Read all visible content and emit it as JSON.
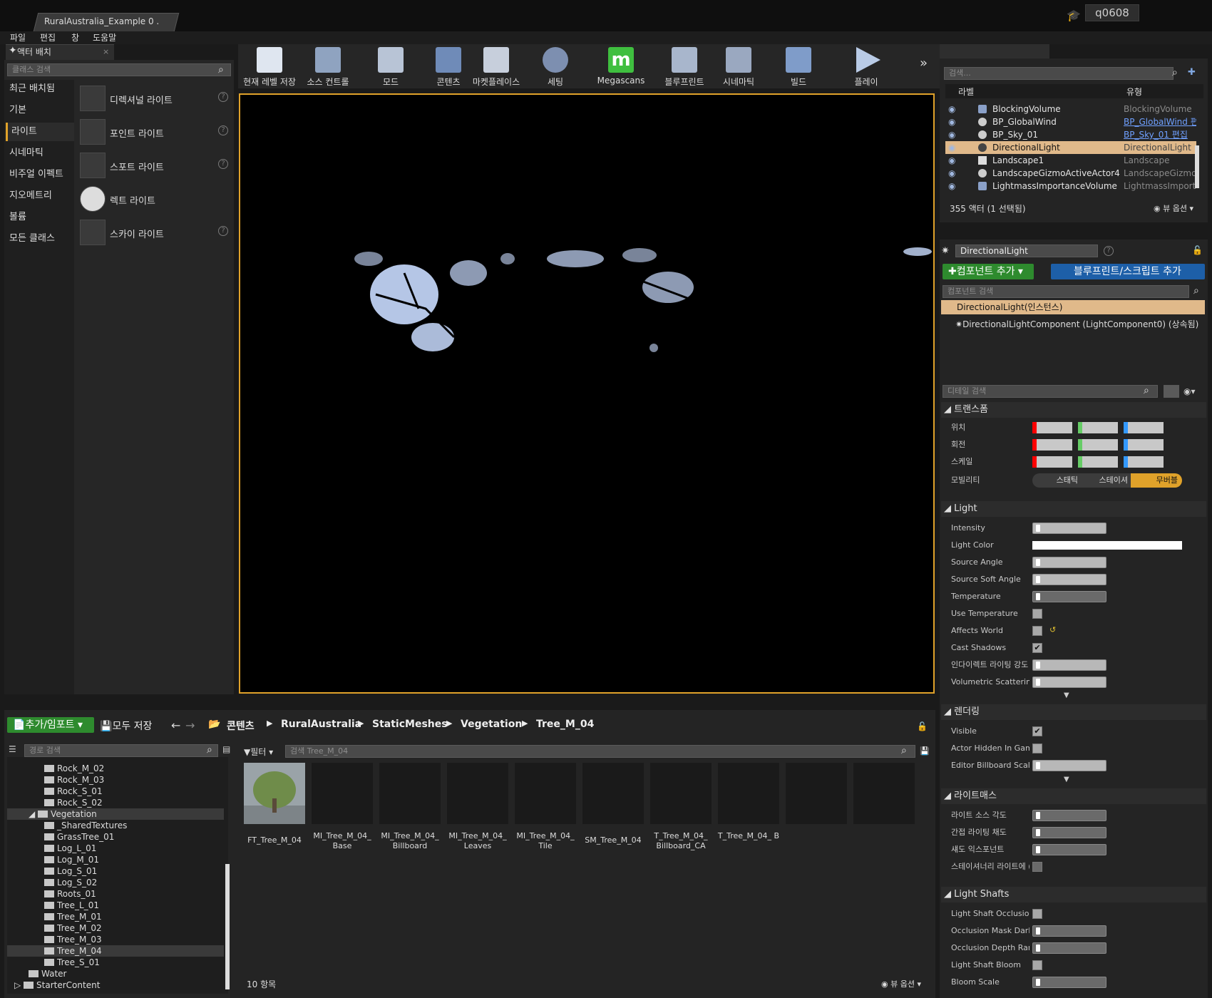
{
  "window": {
    "tab_title": "RuralAustralia_Example 0 .",
    "user": "q0608"
  },
  "menu": [
    "파일",
    "편집",
    "창",
    "도움말"
  ],
  "place_actors": {
    "tab_label": "액터 배치",
    "search_placeholder": "클래스 검색",
    "categories": [
      "최근 배치됨",
      "기본",
      "라이트",
      "시네마틱",
      "비주얼 이펙트",
      "지오메트리",
      "볼륨",
      "모든 클래스"
    ],
    "active_category": "라이트",
    "lights": [
      "디렉셔널 라이트",
      "포인트 라이트",
      "스포트 라이트",
      "렉트 라이트",
      "스카이 라이트"
    ]
  },
  "toolbar": {
    "buttons": [
      "현재 레벨 저장",
      "소스 컨트롤",
      "모드",
      "콘텐츠",
      "마켓플레이스",
      "세팅",
      "Megascans",
      "블루프린트",
      "시네마틱",
      "빌드",
      "플레이"
    ]
  },
  "outliner": {
    "search_placeholder": "검색...",
    "col_label": "라벨",
    "col_type": "유형",
    "rows": [
      {
        "name": "BlockingVolume",
        "type": "BlockingVolume"
      },
      {
        "name": "BP_GlobalWind",
        "type": "BP_GlobalWind 편"
      },
      {
        "name": "BP_Sky_01",
        "type": "BP_Sky_01 편집"
      },
      {
        "name": "DirectionalLight",
        "type": "DirectionalLight"
      },
      {
        "name": "Landscape1",
        "type": "Landscape"
      },
      {
        "name": "LandscapeGizmoActiveActor4",
        "type": "LandscapeGizmo"
      },
      {
        "name": "LightmassImportanceVolume",
        "type": "LightmassImporta"
      }
    ],
    "status": "355 액터 (1 선택됨)",
    "view_options": "뷰 옵션"
  },
  "details": {
    "actor_name": "DirectionalLight",
    "add_component": "컴포넌트 추가",
    "add_blueprint": "블루프린트/스크립트 추가",
    "component_search": "컴포넌트 검색",
    "instance": "DirectionalLight(인스턴스)",
    "component": "DirectionalLightComponent (LightComponent0) (상속됨)",
    "detail_search": "디테일 검색",
    "sections": {
      "transform": "트랜스폼",
      "light": "Light",
      "rendering": "렌더링",
      "lightmass": "라이트매스",
      "light_shafts": "Light Shafts"
    },
    "transform_props": [
      "위치",
      "회전",
      "스케일",
      "모빌리티"
    ],
    "mobility": [
      "스태틱",
      "스테이셔",
      "무버블"
    ],
    "light_props": [
      "Intensity",
      "Light Color",
      "Source Angle",
      "Source Soft Angle",
      "Temperature",
      "Use Temperature",
      "Affects World",
      "Cast Shadows",
      "인다이렉트 라이팅 강도",
      "Volumetric Scattering"
    ],
    "rendering_props": [
      "Visible",
      "Actor Hidden In Game",
      "Editor Billboard Scale"
    ],
    "lightmass_props": [
      "라이트 소스 각도",
      "간접 라이팅 채도",
      "섀도 익스포넌트",
      "스테이셔너리 라이트에 ("
    ],
    "shaft_props": [
      "Light Shaft Occlusion",
      "Occlusion Mask Darkn",
      "Occlusion Depth Rang",
      "Light Shaft Bloom",
      "Bloom Scale"
    ]
  },
  "content_browser": {
    "add_import": "추가/임포트",
    "save_all": "모두 저장",
    "breadcrumbs": [
      "콘텐츠",
      "RuralAustralia",
      "StaticMeshes",
      "Vegetation",
      "Tree_M_04"
    ],
    "path_search": "경로 검색",
    "filter": "필터",
    "asset_search": "검색 Tree_M_04",
    "tree": [
      "Rock_M_02",
      "Rock_M_03",
      "Rock_S_01",
      "Rock_S_02",
      "Vegetation",
      "_SharedTextures",
      "GrassTree_01",
      "Log_L_01",
      "Log_M_01",
      "Log_S_01",
      "Log_S_02",
      "Roots_01",
      "Tree_L_01",
      "Tree_M_01",
      "Tree_M_02",
      "Tree_M_03",
      "Tree_M_04",
      "Tree_S_01",
      "Water",
      "StarterContent"
    ],
    "assets": [
      "FT_Tree_M_04",
      "MI_Tree_M_04_ Base",
      "MI_Tree_M_04_ Billboard",
      "MI_Tree_M_04_ Leaves",
      "MI_Tree_M_04_ Tile",
      "SM_Tree_M_04",
      "T_Tree_M_04_ Billboard_CA",
      "T_Tree_M_04_ B"
    ],
    "item_count": "10 항목",
    "view_options": "뷰 옵션"
  }
}
